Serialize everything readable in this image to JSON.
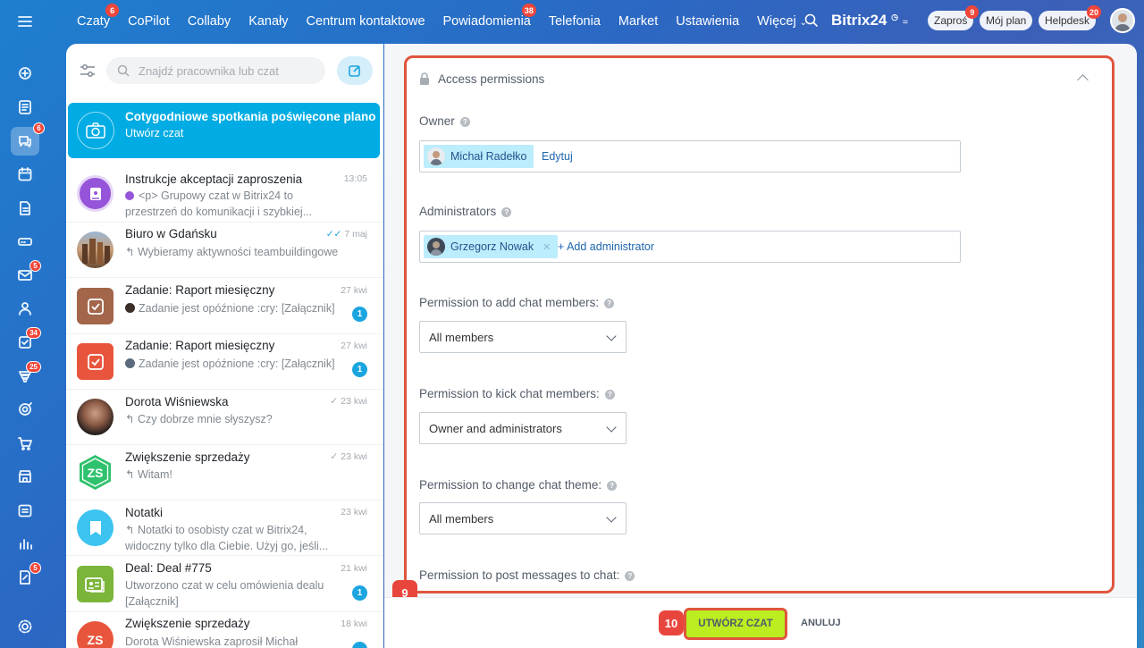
{
  "topnav": {
    "items": [
      {
        "label": "Czaty",
        "badge": "6"
      },
      {
        "label": "CoPilot"
      },
      {
        "label": "Collaby"
      },
      {
        "label": "Kanały"
      },
      {
        "label": "Centrum kontaktowe"
      },
      {
        "label": "Powiadomienia",
        "badge": "38"
      },
      {
        "label": "Telefonia"
      },
      {
        "label": "Market"
      },
      {
        "label": "Ustawienia"
      },
      {
        "label": "Więcej"
      }
    ],
    "brand": "Bitrix",
    "brand_num": "24",
    "invite": "Zaproś",
    "invite_badge": "9",
    "plan": "Mój plan",
    "helpdesk": "Helpdesk",
    "helpdesk_badge": "20"
  },
  "rail": {
    "badges": {
      "chat": "6",
      "mail": "5",
      "tasks": "34",
      "crm": "25",
      "bottom": "5"
    }
  },
  "sidebar": {
    "search_placeholder": "Znajdź pracownika lub czat",
    "new_chat": {
      "title": "Cotygodniowe spotkania poświęcone plano...",
      "subtitle": "Utwórz czat"
    },
    "chats": [
      {
        "title": "Instrukcje akceptacji zaproszenia",
        "time": "13:05",
        "line1": "<p> Grupowy czat w Bitrix24 to",
        "line2": "przestrzeń do komunikacji i szybkiej..."
      },
      {
        "title": "Biuro w Gdańsku",
        "time": "7 maj",
        "line1": "↰ Wybieramy aktywności teambuildingowe"
      },
      {
        "title": "Zadanie: Raport miesięczny",
        "time": "27 kwi",
        "line1": "Zadanie jest opóźnione :cry: [Załącznik]",
        "badge": "1"
      },
      {
        "title": "Zadanie: Raport miesięczny",
        "time": "27 kwi",
        "line1": "Zadanie jest opóźnione :cry: [Załącznik]",
        "badge": "1"
      },
      {
        "title": "Dorota Wiśniewska",
        "time": "23 kwi",
        "line1": "↰ Czy dobrze mnie słyszysz?"
      },
      {
        "title": "Zwiększenie sprzedaży",
        "time": "23 kwi",
        "line1": "↰ Witam!",
        "initials": "ZS"
      },
      {
        "title": "Notatki",
        "time": "23 kwi",
        "line1": "↰ Notatki to osobisty czat w Bitrix24,",
        "line2": "widoczny tylko dla Ciebie. Użyj go, jeśli..."
      },
      {
        "title": "Deal: Deal #775",
        "time": "21 kwi",
        "line1": "Utworzono czat w celu omówienia dealu",
        "line2": "[Załącznik]",
        "badge": "1"
      },
      {
        "title": "Zwiększenie sprzedaży",
        "time": "18 kwi",
        "line1": "Dorota Wiśniewska zaprosił Michał",
        "initials": "ZS"
      }
    ]
  },
  "panel": {
    "title": "Access permissions",
    "owner_label": "Owner",
    "owner_name": "Michał Radełko",
    "owner_edit": "Edytuj",
    "admins_label": "Administrators",
    "admin_name": "Grzegorz Nowak",
    "add_admin": "+ Add administrator",
    "perm_add_label": "Permission to add chat members:",
    "perm_add_value": "All members",
    "perm_kick_label": "Permission to kick chat members:",
    "perm_kick_value": "Owner and administrators",
    "perm_theme_label": "Permission to change chat theme:",
    "perm_theme_value": "All members",
    "perm_post_label": "Permission to post messages to chat:"
  },
  "footer": {
    "step_panel": "9",
    "step_button": "10",
    "create": "UTWÓRZ CZAT",
    "cancel": "ANULUJ"
  },
  "colors": {
    "accent": "#1aa5e0",
    "highlight": "#e0563d",
    "create_btn": "#bbed21"
  }
}
